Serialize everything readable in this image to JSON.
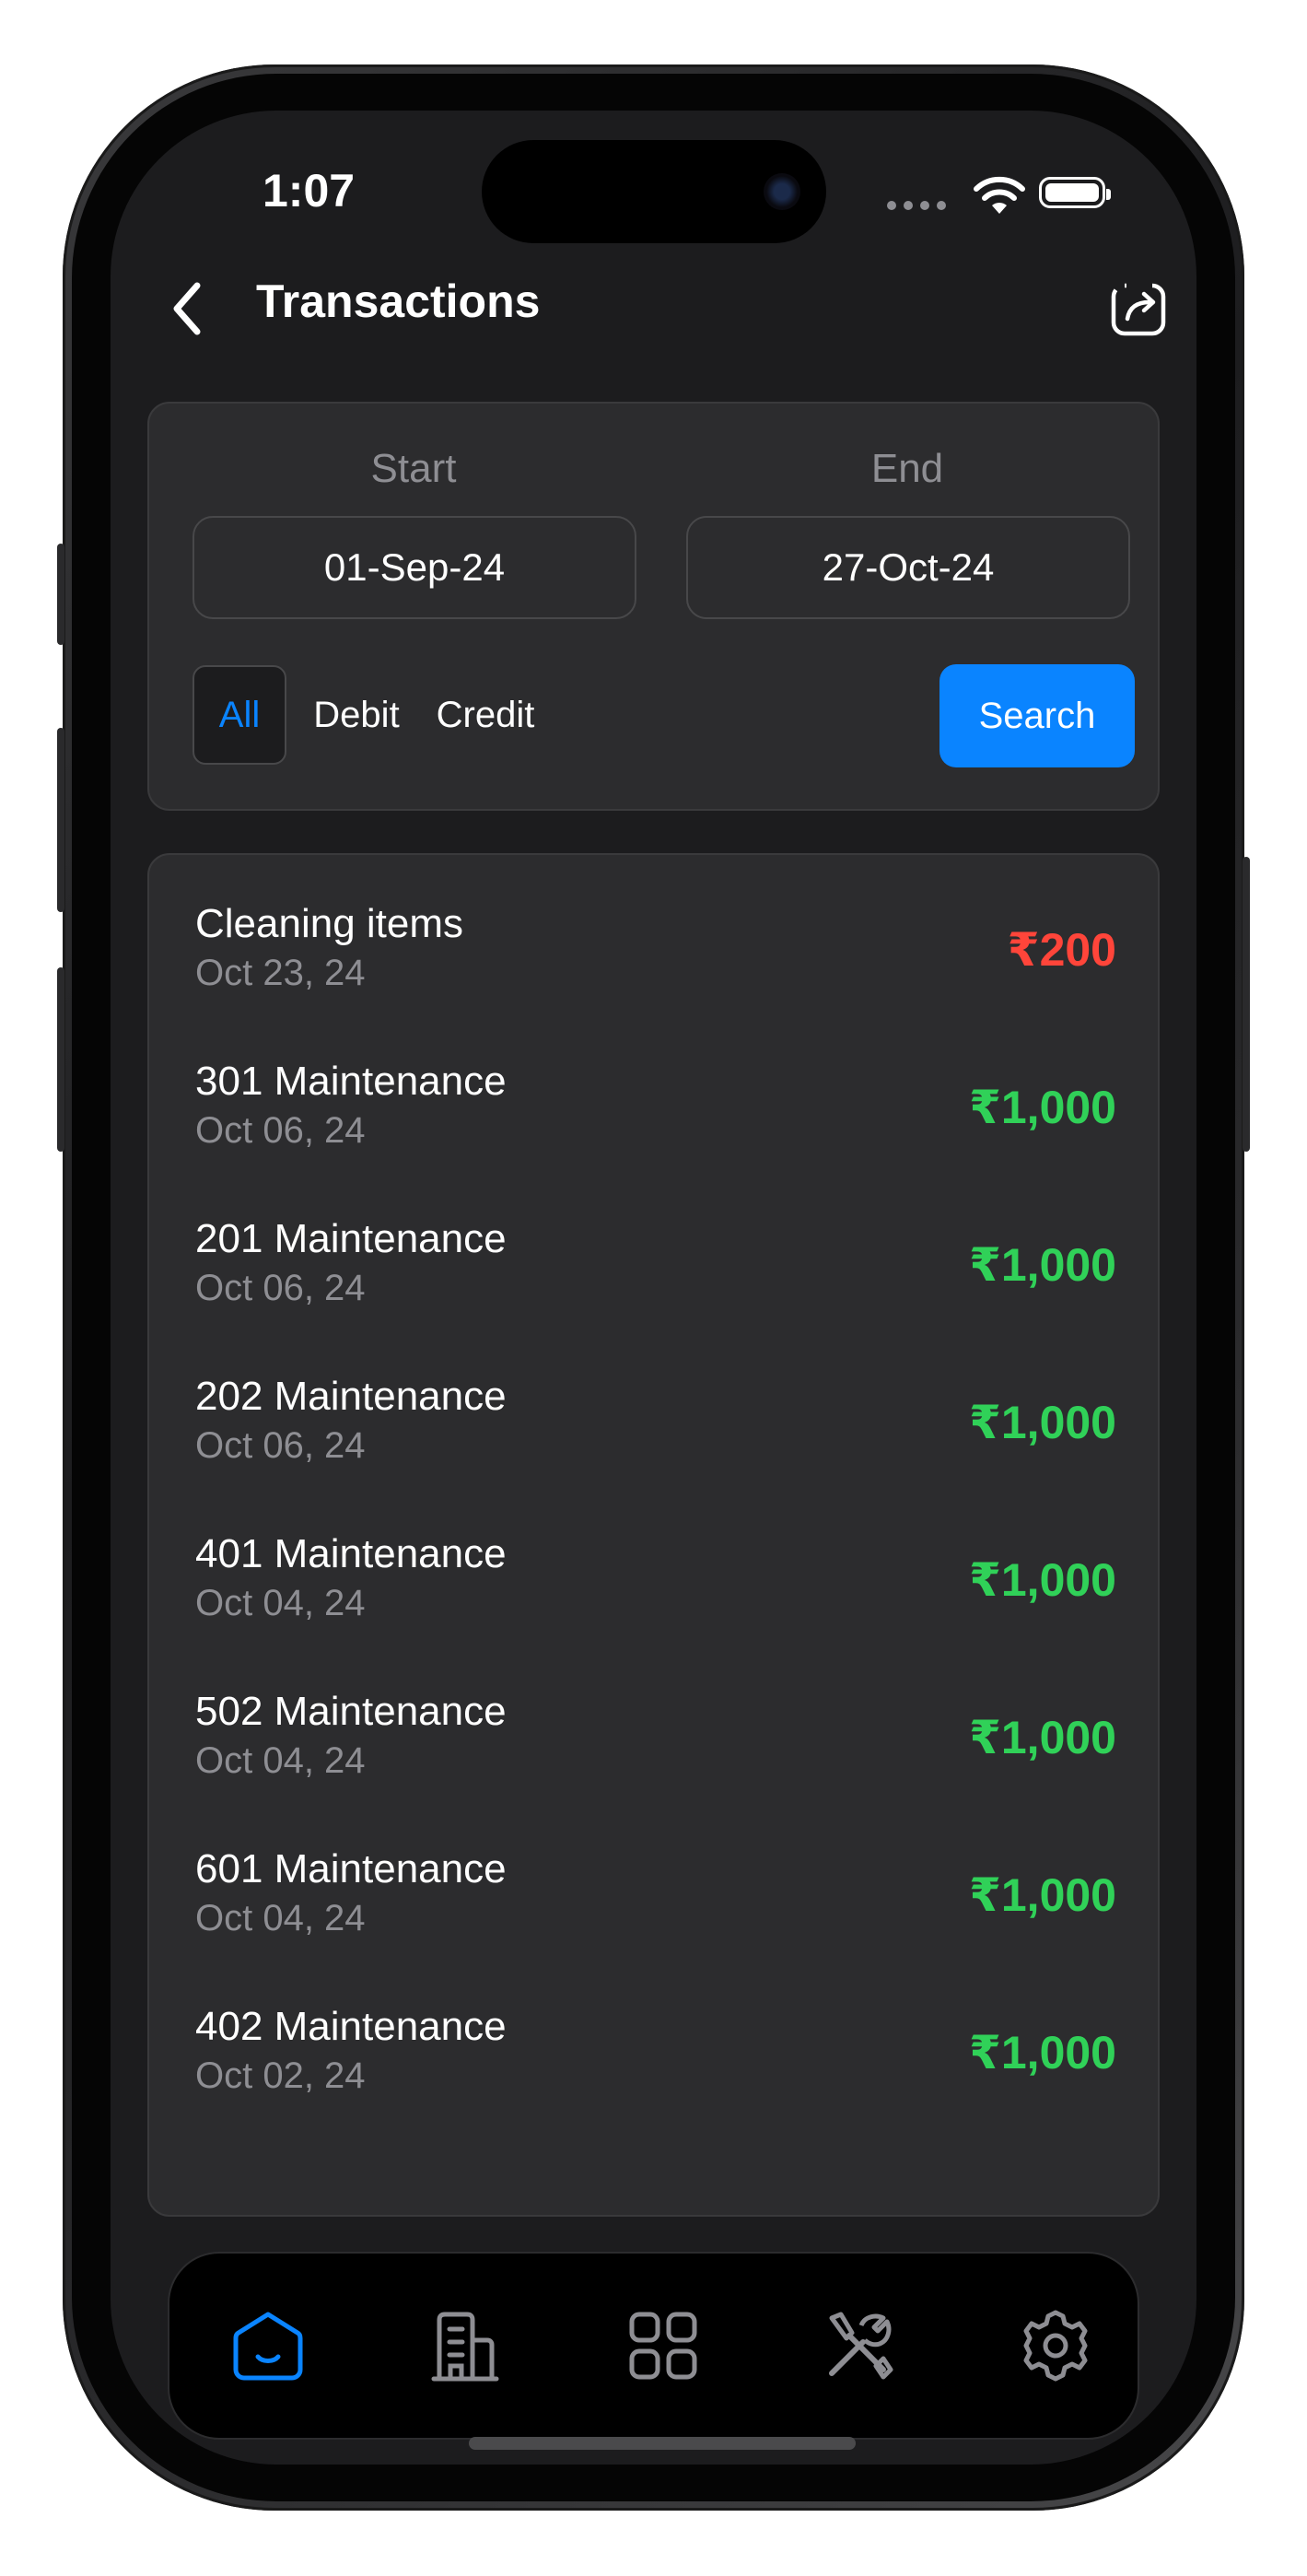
{
  "status_bar": {
    "time": "1:07"
  },
  "header": {
    "title": "Transactions"
  },
  "filters": {
    "start_label": "Start",
    "end_label": "End",
    "start_date": "01-Sep-24",
    "end_date": "27-Oct-24",
    "types": [
      "All",
      "Debit",
      "Credit"
    ],
    "selected_type": "All",
    "search_label": "Search"
  },
  "transactions": [
    {
      "title": "Cleaning items",
      "date": "Oct 23, 24",
      "amount": "₹200",
      "kind": "debit"
    },
    {
      "title": "301 Maintenance",
      "date": "Oct 06, 24",
      "amount": "₹1,000",
      "kind": "credit"
    },
    {
      "title": "201 Maintenance",
      "date": "Oct 06, 24",
      "amount": "₹1,000",
      "kind": "credit"
    },
    {
      "title": "202 Maintenance",
      "date": "Oct 06, 24",
      "amount": "₹1,000",
      "kind": "credit"
    },
    {
      "title": "401 Maintenance",
      "date": "Oct 04, 24",
      "amount": "₹1,000",
      "kind": "credit"
    },
    {
      "title": "502 Maintenance",
      "date": "Oct 04, 24",
      "amount": "₹1,000",
      "kind": "credit"
    },
    {
      "title": "601 Maintenance",
      "date": "Oct 04, 24",
      "amount": "₹1,000",
      "kind": "credit"
    },
    {
      "title": "402 Maintenance",
      "date": "Oct 02, 24",
      "amount": "₹1,000",
      "kind": "credit"
    }
  ],
  "tab_bar": {
    "items": [
      "home-icon",
      "building-icon",
      "grid-icon",
      "tools-icon",
      "settings-icon"
    ],
    "active": "home-icon"
  },
  "colors": {
    "accent": "#0a84ff",
    "debit": "#ff453a",
    "credit": "#30d158",
    "background": "#1c1c1e",
    "card": "#2c2c2e"
  }
}
